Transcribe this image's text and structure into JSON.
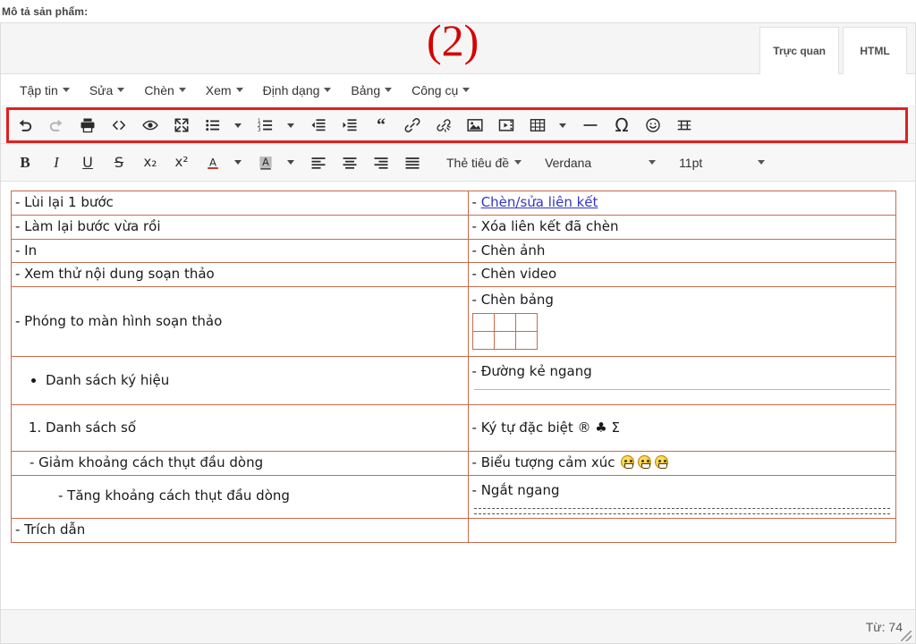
{
  "page": {
    "label": "Mô tả sản phẩm:",
    "annotation": "(2)"
  },
  "colors": {
    "annotation_red": "#d50000",
    "highlight_box": "#e02020",
    "table_border": "#c96b4a",
    "link": "#3535c4"
  },
  "tabs": [
    {
      "label": "Trực quan",
      "active": true
    },
    {
      "label": "HTML",
      "active": false
    }
  ],
  "menubar": [
    {
      "label": "Tập tin"
    },
    {
      "label": "Sửa"
    },
    {
      "label": "Chèn"
    },
    {
      "label": "Xem"
    },
    {
      "label": "Định dạng"
    },
    {
      "label": "Bảng"
    },
    {
      "label": "Công cụ"
    }
  ],
  "toolbar_row1": [
    {
      "icon": "undo-icon",
      "title": "Lùi lại 1 bước",
      "disabled": false
    },
    {
      "icon": "redo-icon",
      "title": "Làm lại bước vừa rồi",
      "disabled": true
    },
    {
      "icon": "print-icon",
      "title": "In"
    },
    {
      "icon": "source-code-icon",
      "title": "Mã nguồn"
    },
    {
      "icon": "preview-eye-icon",
      "title": "Xem thử nội dung soạn thảo"
    },
    {
      "icon": "fullscreen-icon",
      "title": "Phóng to màn hình soạn thảo"
    },
    {
      "icon": "bullet-list-icon",
      "title": "Danh sách ký hiệu",
      "has_caret": true
    },
    {
      "icon": "numbered-list-icon",
      "title": "Danh sách số",
      "has_caret": true
    },
    {
      "icon": "outdent-icon",
      "title": "Giảm khoảng cách thụt đầu dòng"
    },
    {
      "icon": "indent-icon",
      "title": "Tăng khoảng cách thụt đầu dòng"
    },
    {
      "icon": "blockquote-icon",
      "title": "Trích dẫn"
    },
    {
      "icon": "insert-link-icon",
      "title": "Chèn/sửa liên kết"
    },
    {
      "icon": "unlink-icon",
      "title": "Xóa liên kết đã chèn"
    },
    {
      "icon": "insert-image-icon",
      "title": "Chèn ảnh"
    },
    {
      "icon": "insert-video-icon",
      "title": "Chèn video"
    },
    {
      "icon": "insert-table-icon",
      "title": "Chèn bảng",
      "has_caret": true
    },
    {
      "icon": "horizontal-rule-icon",
      "title": "Đường kẻ ngang"
    },
    {
      "icon": "special-character-icon",
      "title": "Ký tự đặc biệt"
    },
    {
      "icon": "emoticon-icon",
      "title": "Biểu tượng cảm xúc"
    },
    {
      "icon": "page-break-icon",
      "title": "Ngắt ngang"
    }
  ],
  "toolbar_row2": {
    "buttons": [
      {
        "icon": "bold-icon",
        "label": "B"
      },
      {
        "icon": "italic-icon",
        "label": "I"
      },
      {
        "icon": "underline-icon",
        "label": "U"
      },
      {
        "icon": "strikethrough-icon",
        "label": "S"
      },
      {
        "icon": "subscript-icon",
        "label": "x₂"
      },
      {
        "icon": "superscript-icon",
        "label": "x²"
      },
      {
        "icon": "text-color-icon",
        "label": "A",
        "has_caret": true
      },
      {
        "icon": "background-color-icon",
        "label": "A",
        "has_caret": true
      },
      {
        "icon": "align-left-icon"
      },
      {
        "icon": "align-center-icon"
      },
      {
        "icon": "align-right-icon"
      },
      {
        "icon": "align-justify-icon"
      }
    ],
    "format_select": "Thẻ tiêu đề",
    "font_select": "Verdana",
    "size_select": "11pt"
  },
  "document": {
    "rows": [
      {
        "left": {
          "text": "- Lùi lại 1 bước",
          "style": "plain"
        },
        "right": {
          "text": "- ",
          "link_text": "Chèn/sửa liên kết",
          "style": "link"
        }
      },
      {
        "left": {
          "text": "- Làm lại bước vừa rồi",
          "style": "plain"
        },
        "right": {
          "text": "- Xóa liên kết đã chèn",
          "style": "plain"
        }
      },
      {
        "left": {
          "text": "- In",
          "style": "plain"
        },
        "right": {
          "text": "- Chèn ảnh",
          "style": "plain"
        }
      },
      {
        "left": {
          "text": "- Xem thử nội dung soạn thảo",
          "style": "plain"
        },
        "right": {
          "text": "- Chèn video",
          "style": "plain"
        }
      },
      {
        "left": {
          "text": "- Phóng to màn hình soạn thảo",
          "style": "plain"
        },
        "right": {
          "text": "- Chèn bảng",
          "style": "mini-table",
          "mini_table_cols": 3,
          "mini_table_rows": 2
        }
      },
      {
        "left": {
          "text": "Danh sách ký hiệu",
          "style": "bullet-list"
        },
        "right": {
          "text": "- Đường kẻ ngang",
          "style": "hrule"
        }
      },
      {
        "left": {
          "text": "Danh sách số",
          "style": "numbered-list"
        },
        "right": {
          "text": "- Ký tự đặc biệt ® ♣ Σ",
          "style": "plain"
        }
      },
      {
        "left": {
          "text": "- Giảm khoảng cách thụt đầu dòng",
          "style": "indent-1"
        },
        "right": {
          "text": "- Biểu tượng cảm xúc",
          "style": "emoticons",
          "emoticon_count": 3
        }
      },
      {
        "left": {
          "text": "- Tăng khoảng cách thụt đầu dòng",
          "style": "indent-2"
        },
        "right": {
          "text": "- Ngắt ngang",
          "style": "page-break"
        }
      },
      {
        "left": {
          "text": "- Trích dẫn",
          "style": "plain"
        },
        "right": {
          "text": "",
          "style": "plain"
        }
      }
    ]
  },
  "statusbar": {
    "word_count": "Từ: 74"
  }
}
